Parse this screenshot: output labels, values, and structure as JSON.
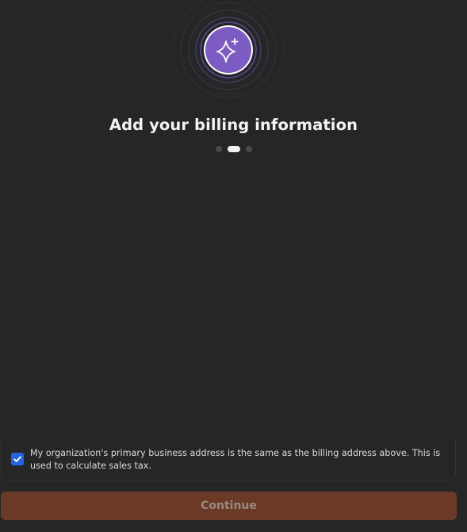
{
  "colors": {
    "background": "#262626",
    "accent_purple": "#7c5cc4",
    "checkbox_blue": "#2563eb",
    "button_bg": "#6a3a26",
    "button_text": "#9a8a82"
  },
  "hero": {
    "icon": "sparkle-icon"
  },
  "title": "Add your billing information",
  "stepper": {
    "total_steps": 3,
    "current_step": 2
  },
  "address_checkbox": {
    "checked": true,
    "label": "My organization's primary business address is the same as the billing address above. This is used to calculate sales tax."
  },
  "continue_button": {
    "label": "Continue"
  }
}
